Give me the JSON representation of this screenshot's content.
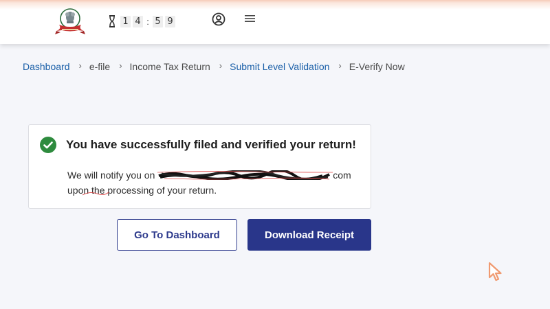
{
  "header": {
    "emblem_icon": "government-emblem",
    "timer": {
      "icon": "hourglass-icon",
      "digits": [
        "1",
        "4",
        "5",
        "9"
      ],
      "separator": ":"
    },
    "profile_icon": "user-circle-icon",
    "menu_icon": "hamburger-menu-icon"
  },
  "breadcrumb": {
    "items": [
      {
        "label": "Dashboard",
        "link": true
      },
      {
        "label": "e-file",
        "link": false
      },
      {
        "label": "Income Tax Return",
        "link": false
      },
      {
        "label": "Submit Level Validation",
        "link": true
      },
      {
        "label": "E-Verify Now",
        "link": false
      }
    ],
    "separator": "›"
  },
  "success_card": {
    "icon": "check-circle-icon",
    "title": "You have successfully filed and verified your return!",
    "message_before": "We will notify you on",
    "email_suffix": "com",
    "message_after": "upon the processing of your return."
  },
  "actions": {
    "dashboard_label": "Go To Dashboard",
    "download_label": "Download Receipt"
  },
  "colors": {
    "primary": "#29368a",
    "link": "#1a5fa8",
    "success": "#2e8b3e",
    "background": "#f5f6fa"
  }
}
